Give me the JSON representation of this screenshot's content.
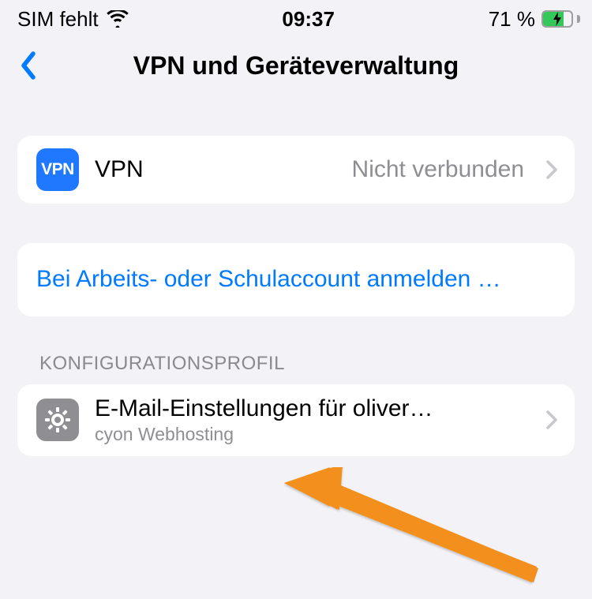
{
  "statusBar": {
    "sim": "SIM fehlt",
    "time": "09:37",
    "batteryText": "71 %",
    "batteryLevel": 71
  },
  "nav": {
    "title": "VPN und Geräteverwaltung"
  },
  "vpnRow": {
    "iconText": "VPN",
    "label": "VPN",
    "status": "Nicht verbunden"
  },
  "signInRow": {
    "text": "Bei Arbeits- oder Schulaccount anmelden …"
  },
  "profileSection": {
    "header": "Konfigurationsprofil",
    "item": {
      "title": "E-Mail-Einstellungen für oliver…",
      "subtitle": "cyon Webhosting"
    }
  }
}
